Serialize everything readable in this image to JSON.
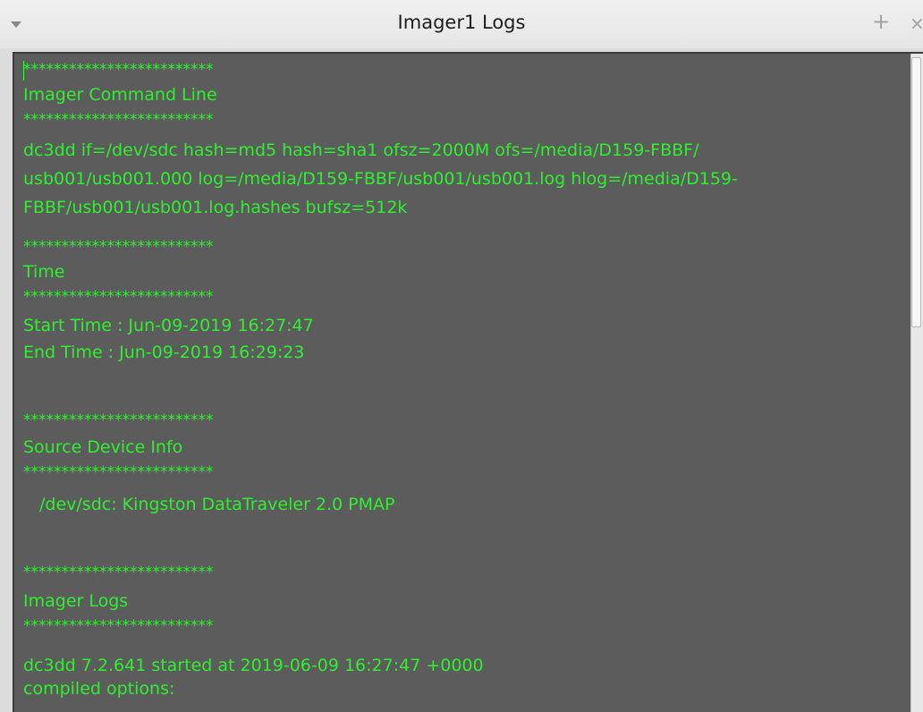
{
  "window": {
    "title": "Imager1 Logs",
    "float_button_label": "+",
    "close_button_label": "×"
  },
  "log": {
    "separator": "*************************",
    "sections": {
      "command_line": {
        "header": "Imager Command Line",
        "lines": [
          "dc3dd if=/dev/sdc hash=md5 hash=sha1 ofsz=2000M ofs=/media/D159-FBBF/",
          "usb001/usb001.000 log=/media/D159-FBBF/usb001/usb001.log hlog=/media/D159-",
          "FBBF/usb001/usb001.log.hashes bufsz=512k"
        ]
      },
      "time": {
        "header": "Time",
        "start_time": "Start Time : Jun-09-2019 16:27:47",
        "end_time": "End Time : Jun-09-2019 16:29:23"
      },
      "source_device": {
        "header": "Source Device Info",
        "device": "/dev/sdc: Kingston  DataTraveler 2.0  PMAP"
      },
      "imager_logs": {
        "header": "Imager Logs",
        "lines": [
          "dc3dd 7.2.641 started at 2019-06-09 16:27:47 +0000",
          "compiled options:"
        ]
      }
    }
  },
  "colors": {
    "log_background": "#5c5c5c",
    "log_text": "#2ef02e",
    "titlebar": "#ececec"
  }
}
